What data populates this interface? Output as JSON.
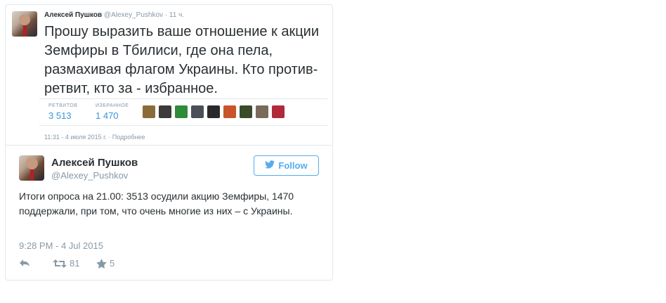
{
  "quoted_tweet": {
    "author_name": "Алексей Пушков",
    "author_handle": "@Alexey_Pushkov",
    "time_ago": "11 ч.",
    "text": "Прошу выразить ваше отношение к акции Земфиры в Тбилиси, где она пела, размахивая флагом Украины. Кто против- ретвит, кто за - избранное.",
    "retweets_label": "РЕТВИТОВ",
    "retweets_count": "3 513",
    "favorites_label": "ИЗБРАННОЕ",
    "favorites_count": "1 470",
    "favoriters_count": 9,
    "favoriter_colors": [
      "#8a6b3a",
      "#3a3a3a",
      "#2f8a3a",
      "#4a4f5a",
      "#2a2a2a",
      "#c9542a",
      "#3a4a2a",
      "#7a6a5a",
      "#b02a3a",
      "#7a3aa0"
    ],
    "timestamp": "11:31 - 4 июля 2015 г.",
    "details_link": "Подробнее"
  },
  "tweet": {
    "author_name": "Алексей Пушков",
    "author_handle": "@Alexey_Pushkov",
    "follow_label": "Follow",
    "text": "Итоги опроса на 21.00: 3513 осудили акцию Земфиры, 1470 поддержали, при том, что очень многие из них – с Украины.",
    "timestamp": "9:28 PM - 4 Jul 2015",
    "retweet_count": "81",
    "favorite_count": "5"
  },
  "colors": {
    "twitter_blue": "#55acee",
    "link_blue": "#3b94d9",
    "muted": "#8899a6",
    "text": "#292f33",
    "border": "#e1e8ed"
  }
}
